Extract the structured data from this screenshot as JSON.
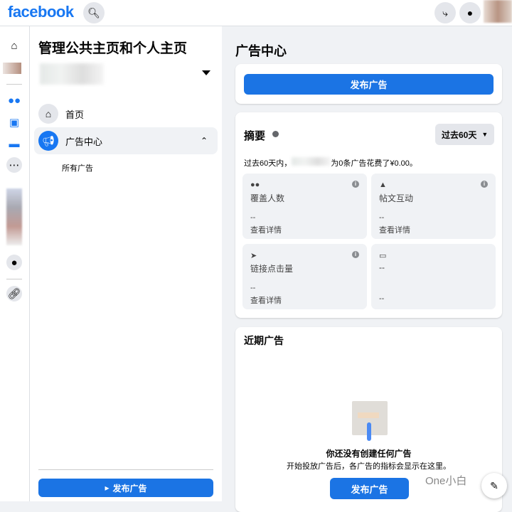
{
  "header": {
    "logo": "facebook"
  },
  "panel": {
    "title": "管理公共主页和个人主页",
    "nav": [
      {
        "label": "首页"
      },
      {
        "label": "广告中心"
      }
    ],
    "subitem": "所有广告",
    "publish_button": "发布广告"
  },
  "main": {
    "title": "广告中心",
    "publish_button": "发布广告",
    "summary": {
      "title": "摘要",
      "range": "过去60天",
      "description_prefix": "过去60天内，",
      "description_suffix": "为0条广告花费了¥0.00。",
      "tiles": [
        {
          "label": "覆盖人数",
          "value": "--",
          "link": "查看详情"
        },
        {
          "label": "帖文互动",
          "value": "--",
          "link": "查看详情"
        },
        {
          "label": "链接点击量",
          "value": "--",
          "link": "查看详情"
        },
        {
          "label": "--",
          "value": "--"
        }
      ]
    },
    "recent": {
      "title": "近期广告",
      "empty_title": "你还没有创建任何广告",
      "empty_desc": "开始投放广告后，各广告的指标会显示在这里。",
      "button": "发布广告"
    }
  },
  "watermark": "One小白",
  "colors": {
    "brand": "#1877f2",
    "button": "#1b74e4"
  }
}
